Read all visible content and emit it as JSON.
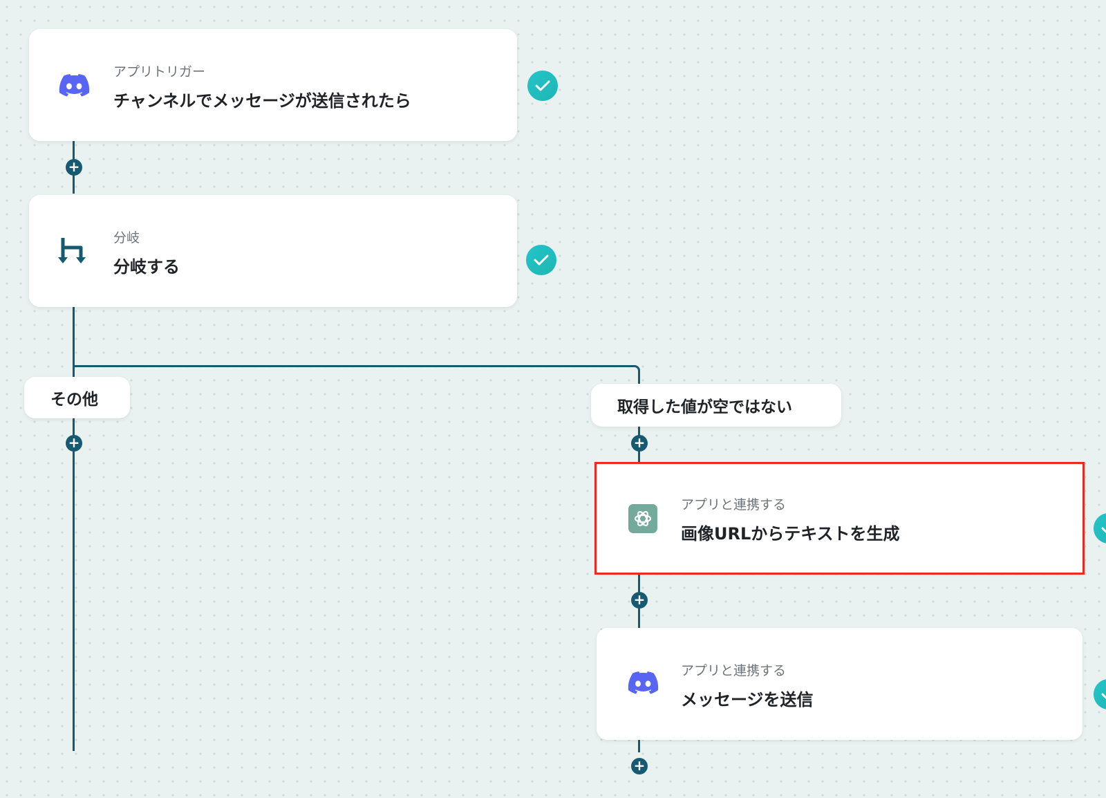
{
  "nodes": [
    {
      "subtitle": "アプリトリガー",
      "title": "チャンネルでメッセージが送信されたら",
      "icon": "discord-icon",
      "status": "completed"
    },
    {
      "subtitle": "分岐",
      "title": "分岐する",
      "icon": "branch-icon",
      "status": "completed"
    },
    {
      "subtitle": "アプリと連携する",
      "title": "画像URLからテキストを生成",
      "icon": "chatgpt-icon",
      "status": "completed",
      "highlighted": true
    },
    {
      "subtitle": "アプリと連携する",
      "title": "メッセージを送信",
      "icon": "discord-icon",
      "status": "completed"
    }
  ],
  "branches": {
    "left_label": "その他",
    "right_label": "取得した値が空ではない"
  },
  "add_step_symbol": "+",
  "colors": {
    "connector": "#165a72",
    "check": "#22bfc2",
    "discord": "#5865f2",
    "chatgpt": "#74aa9c",
    "highlight_border": "#ee2a1e",
    "canvas": "#e9f1f1"
  }
}
